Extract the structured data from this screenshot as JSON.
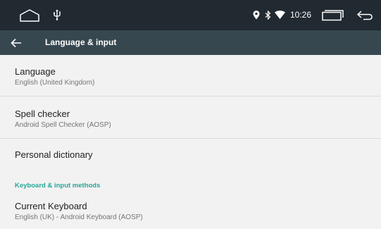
{
  "status_bar": {
    "time": "10:26",
    "icons": [
      "home-outline-icon",
      "usb-icon",
      "location-icon",
      "bluetooth-icon",
      "wifi-icon",
      "recents-icon",
      "back-icon"
    ]
  },
  "toolbar": {
    "title": "Language & input",
    "back_icon": "arrow-left-icon"
  },
  "items": [
    {
      "title": "Language",
      "summary": "English (United Kingdom)"
    },
    {
      "title": "Spell checker",
      "summary": "Android Spell Checker (AOSP)"
    },
    {
      "title": "Personal dictionary"
    }
  ],
  "category": "Keyboard & input methods",
  "current_keyboard": {
    "title": "Current Keyboard",
    "summary": "English (UK) - Android Keyboard (AOSP)"
  },
  "colors": {
    "status_bar": "#212a30",
    "toolbar": "#37474f",
    "accent": "#26a69a",
    "background": "#f2f2f2"
  }
}
